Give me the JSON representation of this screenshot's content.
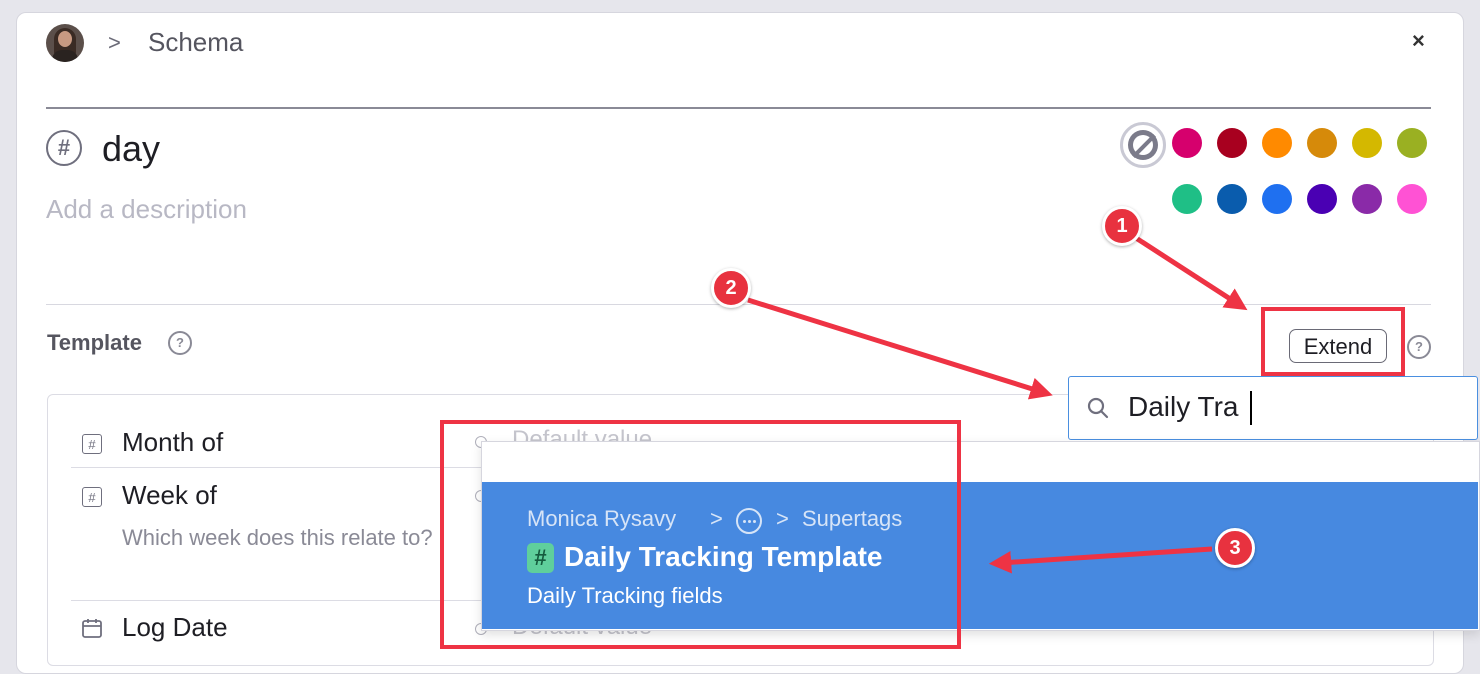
{
  "breadcrumb": {
    "separator": ">",
    "current": "Schema"
  },
  "close_label": "×",
  "tag": {
    "hash": "#",
    "name": "day",
    "description_placeholder": "Add a description"
  },
  "colors": {
    "row1": [
      "#d6006d",
      "#a8001f",
      "#ff8a00",
      "#d68a0a",
      "#d4b800",
      "#9ab022"
    ],
    "row2": [
      "#1fbf86",
      "#0a5cad",
      "#1f70f0",
      "#4a00b3",
      "#8a2aa8",
      "#ff52d4"
    ]
  },
  "template": {
    "title": "Template",
    "help": "?",
    "extend_label": "Extend"
  },
  "fields": [
    {
      "icon": "#",
      "label": "Month of",
      "default_value": "Default value"
    },
    {
      "icon": "#",
      "label": "Week of",
      "description": "Which week does this relate to?"
    },
    {
      "icon": "calendar",
      "label": "Log Date",
      "default_value": "Default value"
    }
  ],
  "search": {
    "value": "Daily Tra"
  },
  "result": {
    "path_owner": "Monica Rysavy",
    "path_sep": ">",
    "path_target": "Supertags",
    "hash": "#",
    "title": "Daily Tracking Template",
    "subtitle": "Daily Tracking fields"
  },
  "annotations": [
    "1",
    "2",
    "3"
  ],
  "annotation_color": "#ee3344"
}
